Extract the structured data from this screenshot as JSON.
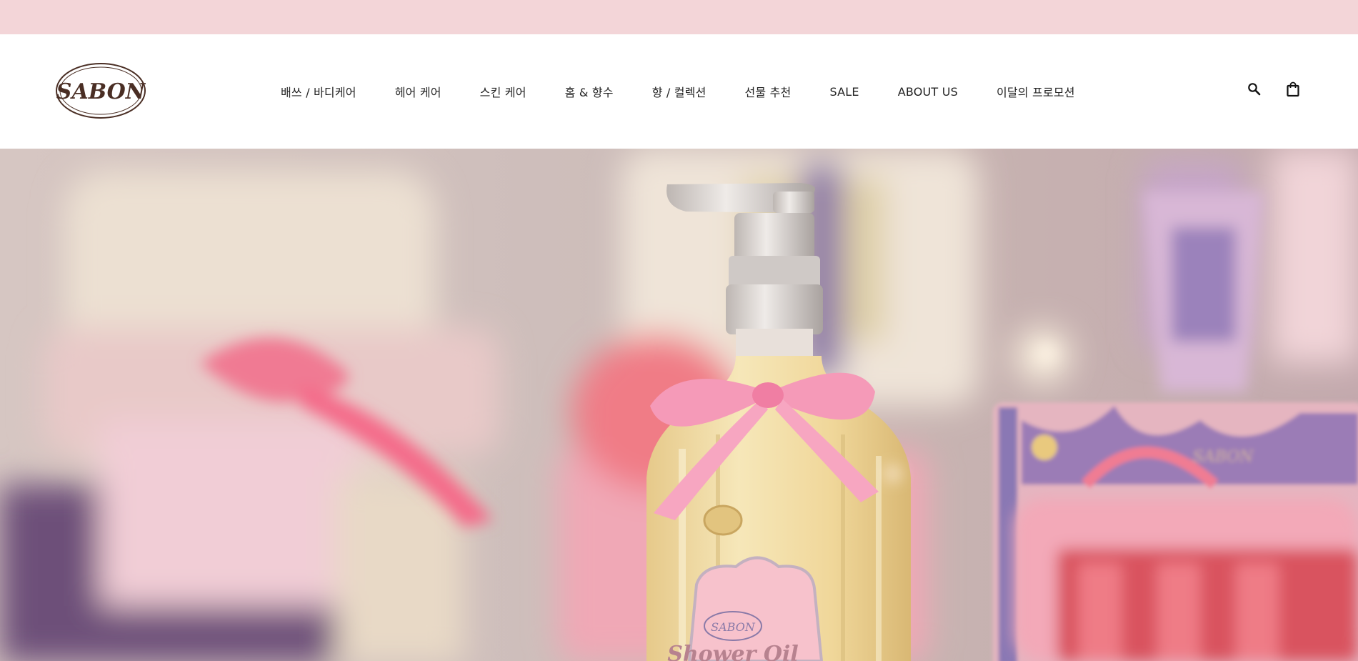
{
  "promo_bar": {
    "color": "#f3d5d8"
  },
  "brand": {
    "logo_text": "SABON",
    "logo_color": "#4a2e24"
  },
  "nav": {
    "items": [
      {
        "label": "배쓰 / 바디케어"
      },
      {
        "label": "헤어 케어"
      },
      {
        "label": "스킨 케어"
      },
      {
        "label": "홈 & 향수"
      },
      {
        "label": "향 / 컬렉션"
      },
      {
        "label": "선물 추천"
      },
      {
        "label": "SALE"
      },
      {
        "label": "ABOUT US"
      },
      {
        "label": "이달의 프로모션"
      }
    ]
  },
  "header_icons": [
    {
      "name": "search-icon"
    },
    {
      "name": "shopping-bag-icon"
    }
  ],
  "hero": {
    "bottle_label_brand": "SABON",
    "bottle_label_product": "Shower Oil",
    "tin_brand": "SABON",
    "dominant_colors": [
      "#c8b7b5",
      "#f0a3b5",
      "#f3e0a8",
      "#8a6ca8"
    ]
  }
}
